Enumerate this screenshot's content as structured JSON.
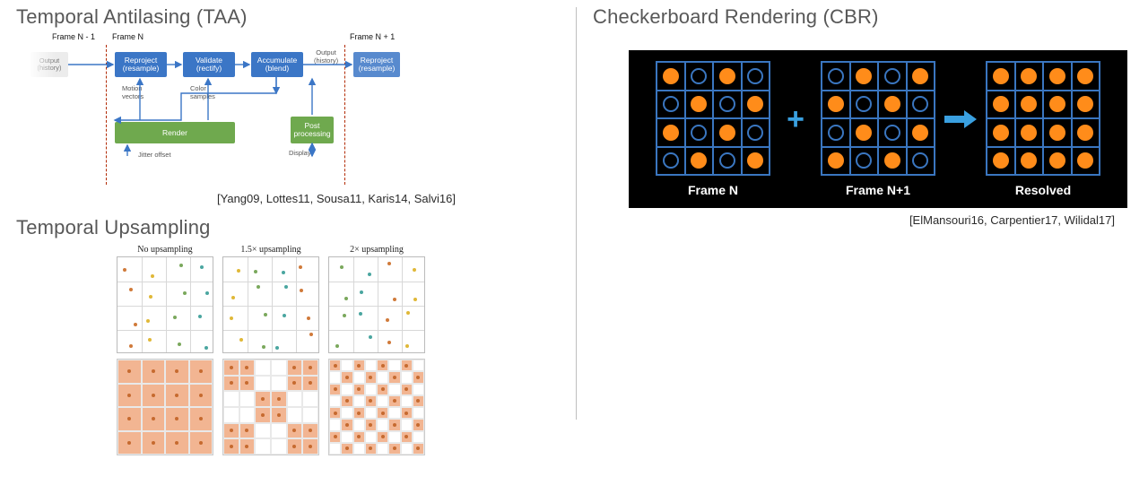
{
  "left": {
    "taa": {
      "title": "Temporal Antilasing (TAA)",
      "citation": "[Yang09, Lottes11, Sousa11, Karis14, Salvi16]",
      "frames": {
        "prev": "Frame N - 1",
        "cur": "Frame N",
        "next": "Frame N + 1"
      },
      "boxes": {
        "reproject": "Reproject\n(resample)",
        "validate": "Validate\n(rectify)",
        "accumulate": "Accumulate\n(blend)",
        "render": "Render",
        "post": "Post\nprocessing"
      },
      "labels": {
        "outhist_l": "Output\n(history)",
        "outhist_r": "Output\n(history)",
        "motion": "Motion\nvectors",
        "colors": "Color\nsamples",
        "jitter": "Jitter offset",
        "display": "Display"
      }
    },
    "upsamp": {
      "title": "Temporal Upsampling",
      "cols": [
        {
          "label": "No upsampling"
        },
        {
          "label": "1.5× upsampling"
        },
        {
          "label": "2× upsampling"
        }
      ]
    }
  },
  "right": {
    "cbr": {
      "title": "Checkerboard Rendering (CBR)",
      "citation": "[ElMansouri16, Carpentier17, Wilidal17]",
      "labels": {
        "n": "Frame N",
        "n1": "Frame N+1",
        "res": "Resolved"
      },
      "plus": "+"
    }
  },
  "chart_data": [
    {
      "type": "diagram",
      "name": "TAA pipeline",
      "nodes": [
        "Reproject (resample)",
        "Validate (rectify)",
        "Accumulate (blend)",
        "Render",
        "Post processing"
      ],
      "edges": [
        [
          "Output (history) prev frame",
          "Reproject (resample)"
        ],
        [
          "Reproject (resample)",
          "Validate (rectify)"
        ],
        [
          "Validate (rectify)",
          "Accumulate (blend)"
        ],
        [
          "Accumulate (blend)",
          "Output (history) next frame"
        ],
        [
          "Render",
          "Motion vectors → Reproject (resample)"
        ],
        [
          "Render",
          "Color samples → Validate (rectify)"
        ],
        [
          "Jitter offset",
          "Render"
        ],
        [
          "Accumulate (blend)",
          "Post processing"
        ],
        [
          "Post processing",
          "Display"
        ]
      ],
      "frames": [
        "Frame N - 1",
        "Frame N",
        "Frame N + 1"
      ]
    },
    {
      "type": "scatter",
      "name": "Temporal Upsampling jitter pattern",
      "variants": [
        "No upsampling",
        "1.5× upsampling",
        "2× upsampling"
      ],
      "grid": "4×4 pixel region with jittered samples"
    },
    {
      "type": "diagram",
      "name": "CBR resolve",
      "grids": [
        {
          "label": "Frame N",
          "size": "4×4",
          "pattern": "checkerboard even = shaded"
        },
        {
          "label": "Frame N+1",
          "size": "4×4",
          "pattern": "checkerboard odd  = shaded"
        },
        {
          "label": "Resolved",
          "size": "4×4",
          "pattern": "all shaded"
        }
      ],
      "ops": [
        "plus",
        "arrow"
      ]
    }
  ]
}
